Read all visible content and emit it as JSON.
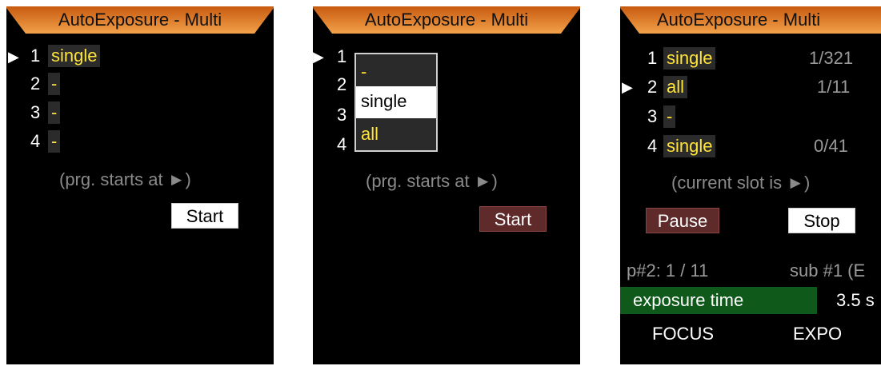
{
  "title": "AutoExposure - Multi",
  "screen1": {
    "slots": [
      {
        "num": "1",
        "value": "single"
      },
      {
        "num": "2",
        "value": "-"
      },
      {
        "num": "3",
        "value": "-"
      },
      {
        "num": "4",
        "value": "-"
      }
    ],
    "hint": "(prg. starts at ►)",
    "start_label": "Start"
  },
  "screen2": {
    "slot_numbers": [
      "1",
      "2",
      "3",
      "4"
    ],
    "dropdown_options": [
      "-",
      "single",
      "all"
    ],
    "hint": "(prg. starts at ►)",
    "start_label": "Start"
  },
  "screen3": {
    "slots": [
      {
        "num": "1",
        "value": "single",
        "progress": "1/321"
      },
      {
        "num": "2",
        "value": "all",
        "progress": "1/11"
      },
      {
        "num": "3",
        "value": "-",
        "progress": ""
      },
      {
        "num": "4",
        "value": "single",
        "progress": "0/41"
      }
    ],
    "hint": "(current slot is ►)",
    "pause_label": "Pause",
    "stop_label": "Stop",
    "program_status": "p#2: 1 / 11",
    "sub_status": "sub #1 (E",
    "param_label": "exposure time",
    "param_value": "3.5 s",
    "footer": {
      "left": "FOCUS",
      "right": "EXPO"
    }
  },
  "colors": {
    "title_orange": "#e07a1a",
    "highlight_yellow": "#ffe33a",
    "green_bar": "#0f5a1a"
  }
}
